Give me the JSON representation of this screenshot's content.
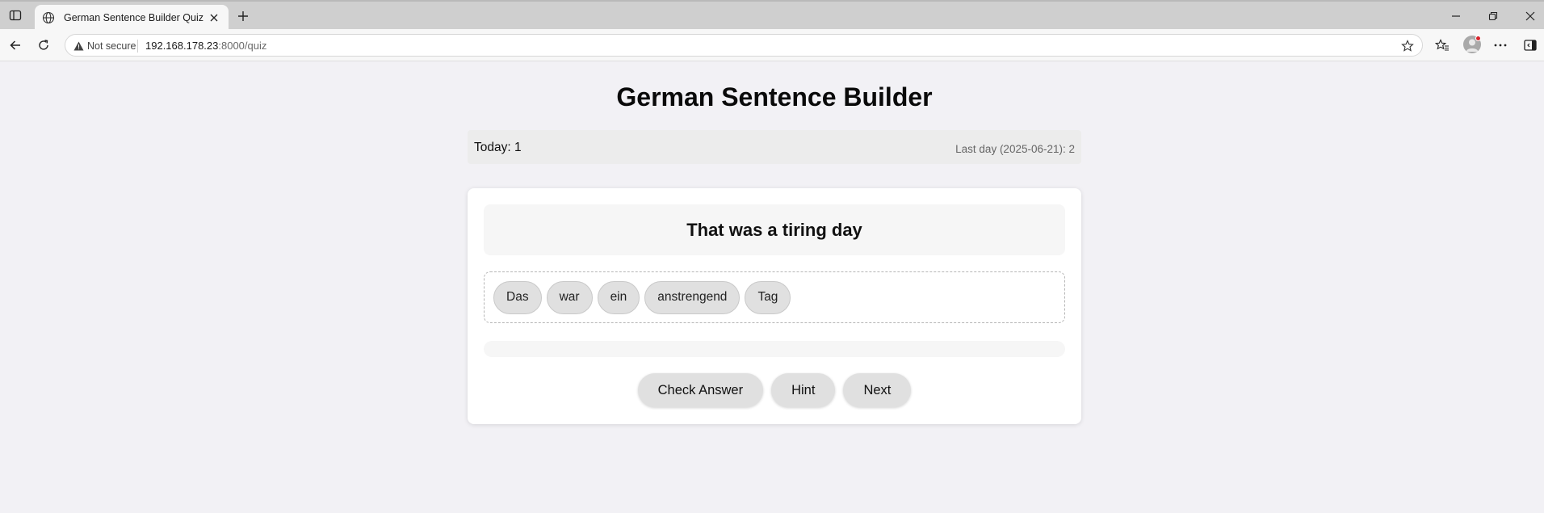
{
  "browser": {
    "tab_title": "German Sentence Builder Quiz",
    "security_label": "Not secure",
    "url_host": "192.168.178.23",
    "url_rest": ":8000/quiz"
  },
  "page": {
    "title": "German Sentence Builder",
    "stats": {
      "today": "Today: 1",
      "last_day": "Last day (2025-06-21): 2"
    },
    "prompt": "That was a tiring day",
    "words": [
      "Das",
      "war",
      "ein",
      "anstrengend",
      "Tag"
    ],
    "buttons": {
      "check": "Check Answer",
      "hint": "Hint",
      "next": "Next"
    }
  }
}
